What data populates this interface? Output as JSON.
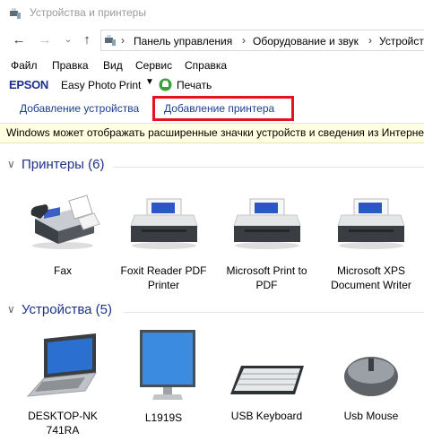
{
  "window": {
    "title": "Устройства и принтеры"
  },
  "address": {
    "crumbs": [
      "Панель управления",
      "Оборудование и звук",
      "Устройст"
    ]
  },
  "menu": {
    "items": [
      "Файл",
      "Правка",
      "Вид",
      "Сервис",
      "Справка"
    ]
  },
  "epson": {
    "logo": "EPSON",
    "app": "Easy Photo Print",
    "print": "Печать"
  },
  "commands": {
    "add_device": "Добавление устройства",
    "add_printer": "Добавление принтера"
  },
  "infobar": {
    "text": "Windows может отображать расширенные значки устройств и сведения из Интерне"
  },
  "groups": {
    "printers": {
      "label": "Принтеры (6)",
      "items": [
        {
          "name": "Fax",
          "icon": "fax-icon"
        },
        {
          "name": "Foxit Reader PDF Printer",
          "icon": "printer-icon"
        },
        {
          "name": "Microsoft Print to PDF",
          "icon": "printer-icon"
        },
        {
          "name": "Microsoft XPS Document Writer",
          "icon": "printer-icon"
        }
      ]
    },
    "devices": {
      "label": "Устройства (5)",
      "items": [
        {
          "name": "DESKTOP-NK741RA",
          "icon": "laptop-icon"
        },
        {
          "name": "L1919S",
          "icon": "monitor-icon"
        },
        {
          "name": "USB Keyboard",
          "icon": "keyboard-icon"
        },
        {
          "name": "Usb Mouse",
          "icon": "mouse-icon"
        }
      ]
    }
  },
  "colors": {
    "highlight_border": "#e81123",
    "group_header": "#1e3287",
    "infobar_bg": "#ffffe1"
  }
}
